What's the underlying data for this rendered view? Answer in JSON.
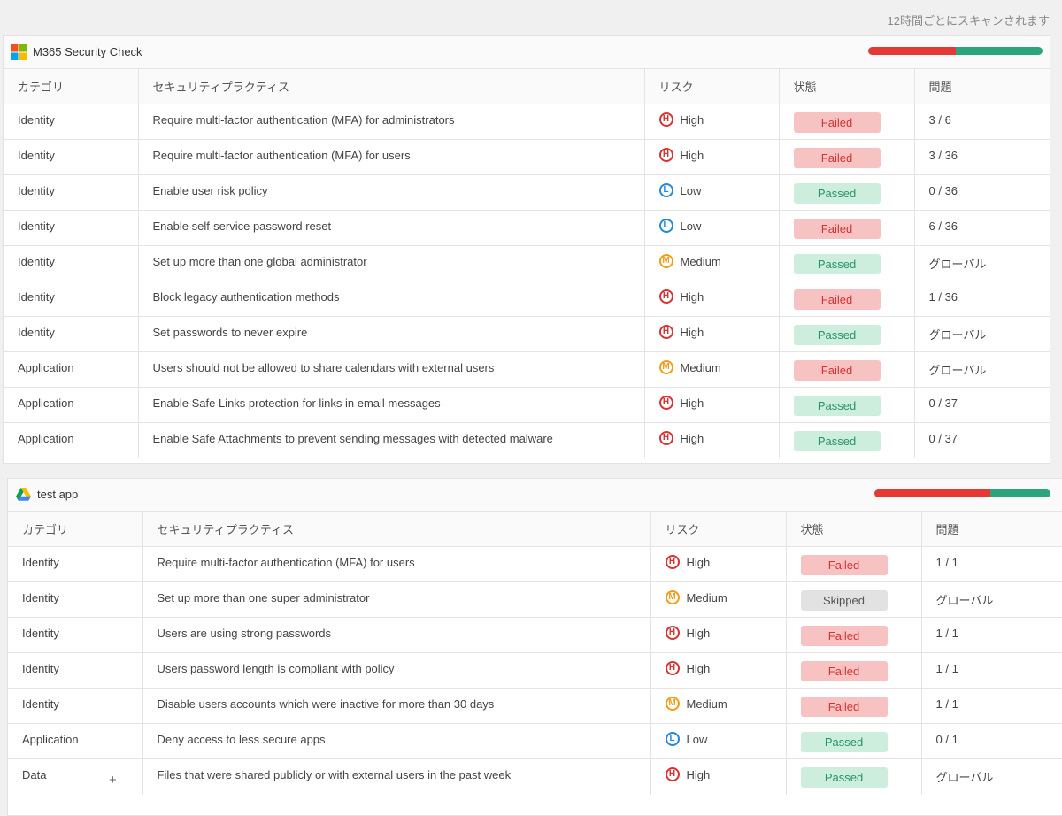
{
  "scan_note": "12時間ごとにスキャンされます",
  "columns": [
    "カテゴリ",
    "セキュリティプラクティス",
    "リスク",
    "状態",
    "問題"
  ],
  "colors": {
    "high": "#d63333",
    "medium": "#f29d1a",
    "low": "#2588d8",
    "failed_bar": "#e53935",
    "passed_bar": "#2ba57c"
  },
  "sections": [
    {
      "title": "M365 Security Check",
      "logo_icon": "microsoft-logo-icon",
      "progress": {
        "failed_fraction": 0.5,
        "passed_fraction": 0.5
      },
      "rows": [
        {
          "category": "Identity",
          "practice": "Require multi-factor authentication (MFA) for administrators",
          "risk_code": "H",
          "risk": "High",
          "status": "Failed",
          "issues": "3 / 6"
        },
        {
          "category": "Identity",
          "practice": "Require multi-factor authentication (MFA) for users",
          "risk_code": "H",
          "risk": "High",
          "status": "Failed",
          "issues": "3 / 36"
        },
        {
          "category": "Identity",
          "practice": "Enable user risk policy",
          "risk_code": "L",
          "risk": "Low",
          "status": "Passed",
          "issues": "0 / 36"
        },
        {
          "category": "Identity",
          "practice": "Enable self-service password reset",
          "risk_code": "L",
          "risk": "Low",
          "status": "Failed",
          "issues": "6 / 36"
        },
        {
          "category": "Identity",
          "practice": "Set up more than one global administrator",
          "risk_code": "M",
          "risk": "Medium",
          "status": "Passed",
          "issues": "グローバル"
        },
        {
          "category": "Identity",
          "practice": "Block legacy authentication methods",
          "risk_code": "H",
          "risk": "High",
          "status": "Failed",
          "issues": "1 / 36"
        },
        {
          "category": "Identity",
          "practice": "Set passwords to never expire",
          "risk_code": "H",
          "risk": "High",
          "status": "Passed",
          "issues": "グローバル"
        },
        {
          "category": "Application",
          "practice": "Users should not be allowed to share calendars with external users",
          "risk_code": "M",
          "risk": "Medium",
          "status": "Failed",
          "issues": "グローバル"
        },
        {
          "category": "Application",
          "practice": "Enable Safe Links protection for links in email messages",
          "risk_code": "H",
          "risk": "High",
          "status": "Passed",
          "issues": "0 / 37"
        },
        {
          "category": "Application",
          "practice": "Enable Safe Attachments to prevent sending messages with detected malware",
          "risk_code": "H",
          "risk": "High",
          "status": "Passed",
          "issues": "0 / 37"
        }
      ]
    },
    {
      "title": "test app",
      "logo_icon": "google-drive-logo-icon",
      "progress": {
        "failed_fraction": 0.66,
        "passed_fraction": 0.34
      },
      "rows": [
        {
          "category": "Identity",
          "practice": "Require multi-factor authentication (MFA) for users",
          "risk_code": "H",
          "risk": "High",
          "status": "Failed",
          "issues": "1 / 1"
        },
        {
          "category": "Identity",
          "practice": "Set up more than one super administrator",
          "risk_code": "M",
          "risk": "Medium",
          "status": "Skipped",
          "issues": "グローバル"
        },
        {
          "category": "Identity",
          "practice": "Users are using strong passwords",
          "risk_code": "H",
          "risk": "High",
          "status": "Failed",
          "issues": "1 / 1"
        },
        {
          "category": "Identity",
          "practice": "Users password length is compliant with policy",
          "risk_code": "H",
          "risk": "High",
          "status": "Failed",
          "issues": "1 / 1"
        },
        {
          "category": "Identity",
          "practice": "Disable users accounts which were inactive for more than 30 days",
          "risk_code": "M",
          "risk": "Medium",
          "status": "Failed",
          "issues": "1 / 1"
        },
        {
          "category": "Application",
          "practice": "Deny access to less secure apps",
          "risk_code": "L",
          "risk": "Low",
          "status": "Passed",
          "issues": "0 / 1"
        },
        {
          "category": "Data",
          "practice": "Files that were shared publicly or with external users in the past week",
          "risk_code": "H",
          "risk": "High",
          "status": "Passed",
          "issues": "グローバル"
        }
      ]
    }
  ],
  "plus_symbol": "+"
}
